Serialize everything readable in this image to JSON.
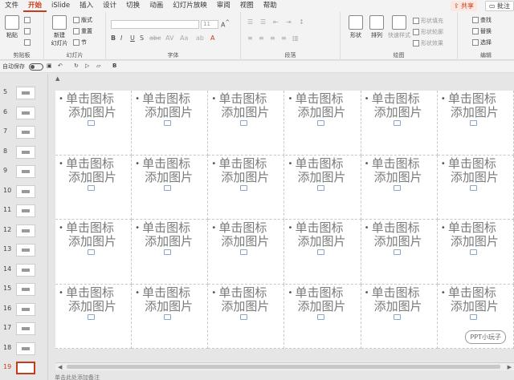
{
  "tabs": [
    "文件",
    "开始",
    "iSlide",
    "插入",
    "设计",
    "切换",
    "动画",
    "幻灯片放映",
    "审阅",
    "视图",
    "帮助"
  ],
  "active_tab": "开始",
  "share_label": "共享",
  "comment_label": "批注",
  "ribbon": {
    "clipboard": {
      "paste": "粘贴",
      "group": "剪贴板"
    },
    "slides": {
      "new_slide": "新建\n幻灯片",
      "layout": "版式",
      "reset": "重置",
      "section": "节",
      "group": "幻灯片"
    },
    "font": {
      "group": "字体",
      "size_placeholder": "11"
    },
    "paragraph": {
      "group": "段落"
    },
    "drawing": {
      "shape": "形状",
      "arrange": "排列",
      "quick_styles": "快速样式",
      "fill": "形状填充",
      "outline": "形状轮廓",
      "effects": "形状效果",
      "group": "绘图"
    },
    "editing": {
      "find": "查找",
      "replace": "替换",
      "select": "选择",
      "group": "编辑"
    }
  },
  "qat": {
    "autosave": "自动保存",
    "toggle_state": "关"
  },
  "thumbnails": [
    "5",
    "6",
    "7",
    "8",
    "9",
    "10",
    "11",
    "12",
    "13",
    "14",
    "15",
    "16",
    "17",
    "18",
    "19"
  ],
  "active_thumbnail": "19",
  "placeholder": {
    "line1": "单击图标",
    "line2": "添加图片"
  },
  "grid": {
    "rows": 4,
    "cols": 6
  },
  "watermark": "PPT小玩子",
  "notes": "单击此处添加备注"
}
